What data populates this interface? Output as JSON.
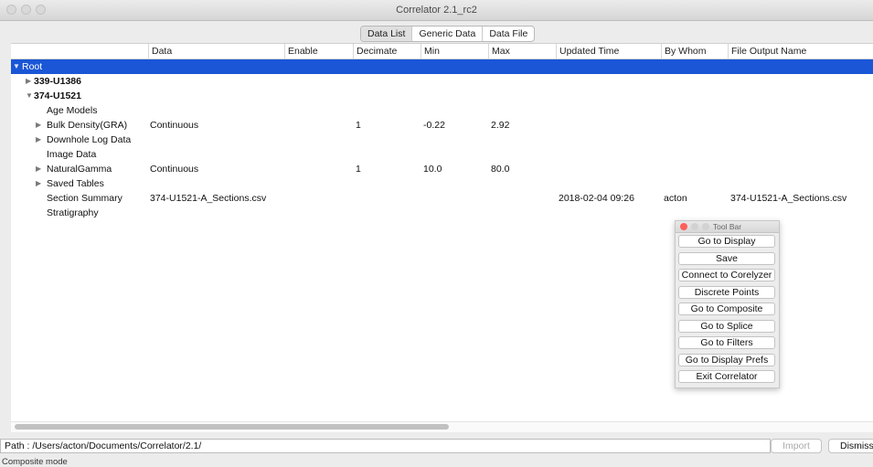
{
  "window": {
    "title": "Correlator 2.1_rc2"
  },
  "tabs": [
    {
      "label": "Data List",
      "active": true
    },
    {
      "label": "Generic Data",
      "active": false
    },
    {
      "label": "Data File",
      "active": false
    }
  ],
  "table": {
    "columns": [
      "Data",
      "Enable",
      "Decimate",
      "Min",
      "Max",
      "Updated Time",
      "By Whom",
      "File Output Name"
    ],
    "rows": [
      {
        "name": "Root",
        "expand": "▼",
        "selected": true,
        "data": "",
        "enable": "",
        "decimate": "",
        "min": "",
        "max": "",
        "updated": "",
        "by": "",
        "file": ""
      },
      {
        "name": "339-U1386",
        "expand": "▶",
        "bold": true,
        "data": "",
        "enable": "",
        "decimate": "",
        "min": "",
        "max": "",
        "updated": "",
        "by": "",
        "file": ""
      },
      {
        "name": "374-U1521",
        "expand": "▼",
        "bold": true,
        "data": "",
        "enable": "",
        "decimate": "",
        "min": "",
        "max": "",
        "updated": "",
        "by": "",
        "file": ""
      },
      {
        "name": "Age Models",
        "expand": "",
        "data": "",
        "enable": "",
        "decimate": "",
        "min": "",
        "max": "",
        "updated": "",
        "by": "",
        "file": ""
      },
      {
        "name": "Bulk Density(GRA)",
        "expand": "▶",
        "data": "Continuous",
        "enable": "",
        "decimate": "1",
        "min": "-0.22",
        "max": "2.92",
        "updated": "",
        "by": "",
        "file": ""
      },
      {
        "name": "Downhole Log Data",
        "expand": "▶",
        "data": "",
        "enable": "",
        "decimate": "",
        "min": "",
        "max": "",
        "updated": "",
        "by": "",
        "file": ""
      },
      {
        "name": "Image Data",
        "expand": "",
        "data": "",
        "enable": "",
        "decimate": "",
        "min": "",
        "max": "",
        "updated": "",
        "by": "",
        "file": ""
      },
      {
        "name": "NaturalGamma",
        "expand": "▶",
        "data": "Continuous",
        "enable": "",
        "decimate": "1",
        "min": "10.0",
        "max": "80.0",
        "updated": "",
        "by": "",
        "file": ""
      },
      {
        "name": "Saved Tables",
        "expand": "▶",
        "data": "",
        "enable": "",
        "decimate": "",
        "min": "",
        "max": "",
        "updated": "",
        "by": "",
        "file": ""
      },
      {
        "name": "Section Summary",
        "expand": "",
        "data": "374-U1521-A_Sections.csv",
        "enable": "",
        "decimate": "",
        "min": "",
        "max": "",
        "updated": "2018-02-04 09:26",
        "by": "acton",
        "file": "374-U1521-A_Sections.csv"
      },
      {
        "name": "Stratigraphy",
        "expand": "",
        "data": "",
        "enable": "",
        "decimate": "",
        "min": "",
        "max": "",
        "updated": "",
        "by": "",
        "file": ""
      }
    ]
  },
  "footer": {
    "path": "Path : /Users/acton/Documents/Correlator/2.1/",
    "import_label": "Import",
    "dismiss_label": "Dismiss",
    "status": "Composite mode"
  },
  "toolbar": {
    "title": "Tool Bar",
    "buttons": [
      "Go to Display",
      "Save",
      "Connect to Corelyzer",
      "Discrete Points",
      "Go to Composite",
      "Go to Splice",
      "Go to Filters",
      "Go to Display Prefs",
      "Exit Correlator"
    ]
  },
  "colors": {
    "selection": "#1a56d6",
    "close_dot": "#fc605b"
  }
}
